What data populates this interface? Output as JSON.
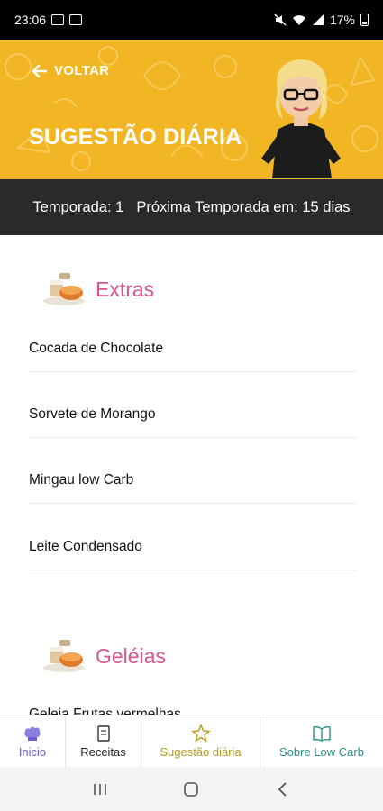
{
  "status": {
    "time": "23:06",
    "battery": "17%"
  },
  "header": {
    "back_label": "VOLTAR",
    "title": "SUGESTÃO DIÁRIA"
  },
  "season": {
    "current": "Temporada: 1",
    "next": "Próxima Temporada em: 15 dias"
  },
  "sections": [
    {
      "title": "Extras",
      "items": [
        "Cocada de Chocolate",
        "Sorvete de Morango",
        "Mingau low Carb",
        "Leite Condensado"
      ]
    },
    {
      "title": "Geléias",
      "items": [
        "Geleia Frutas vermelhas"
      ]
    }
  ],
  "tabs": [
    {
      "label": "Inicio",
      "icon": "chef-hat-icon",
      "color": "#6b5bd6"
    },
    {
      "label": "Receitas",
      "icon": "recipe-book-icon",
      "color": "#222222"
    },
    {
      "label": "Sugestão diária",
      "icon": "star-icon",
      "color": "#b89a1a"
    },
    {
      "label": "Sobre Low Carb",
      "icon": "open-book-icon",
      "color": "#2f8f86"
    }
  ],
  "colors": {
    "header": "#f2b624",
    "season_bar": "#2a2a2a",
    "section_title": "#d9558a"
  }
}
